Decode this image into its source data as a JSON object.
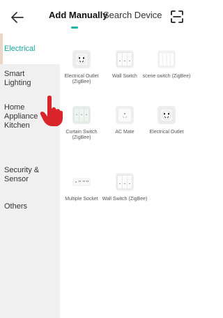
{
  "header": {
    "tabs": [
      {
        "label": "Add Manually",
        "active": true
      },
      {
        "label": "Search Device",
        "active": false
      }
    ]
  },
  "sidebar": {
    "categories": [
      {
        "label": "Electrical",
        "active": true
      },
      {
        "label": "Smart Lighting"
      },
      {
        "label": "Home Appliance"
      },
      {
        "label": "Kitchen"
      },
      {
        "label": "Security & Sensor"
      },
      {
        "label": "Others"
      }
    ]
  },
  "devices": [
    {
      "label": "Electrical Outlet (ZigBee)",
      "icon": "outlet-icon"
    },
    {
      "label": "Wall Switch",
      "icon": "wall-switch-icon"
    },
    {
      "label": "scene switch (ZigBee)",
      "icon": "scene-switch-icon"
    },
    {
      "label": "Curtain Switch (ZigBee)",
      "icon": "curtain-switch-icon"
    },
    {
      "label": "AC Mate",
      "icon": "ac-mate-icon"
    },
    {
      "label": "Electrical Outlet",
      "icon": "outlet-icon"
    },
    {
      "label": "Multiple Socket",
      "icon": "multiple-socket-icon"
    },
    {
      "label": "Wall Switch (ZigBee)",
      "icon": "wall-switch-icon"
    }
  ],
  "colors": {
    "accent": "#19b5a5",
    "sidebar_bg": "#f0f0f0",
    "pointer": "#d8242a"
  }
}
